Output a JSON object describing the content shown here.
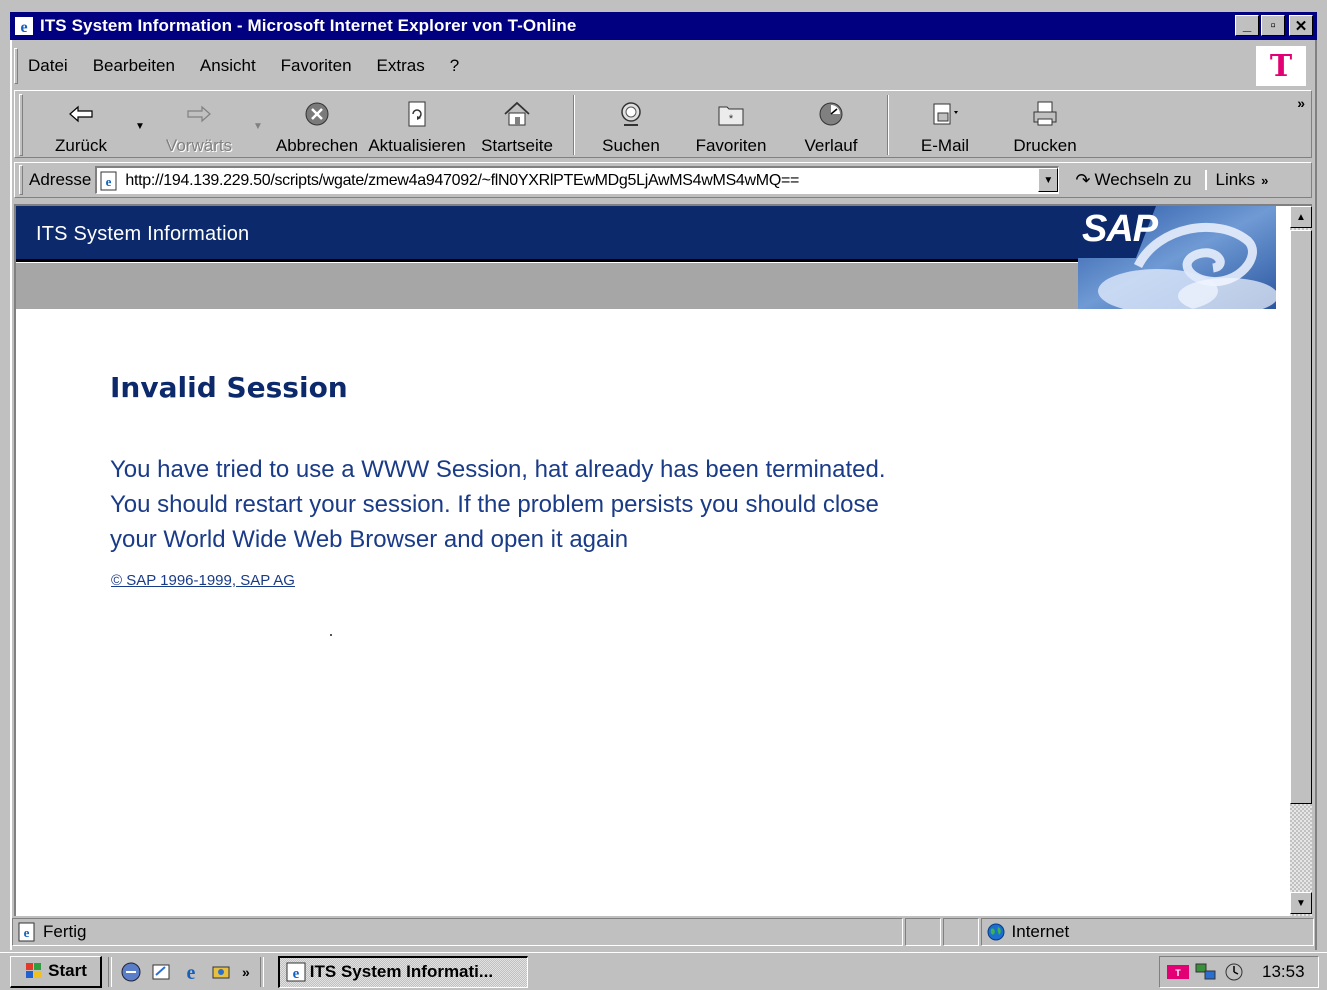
{
  "window": {
    "title": "ITS System Information - Microsoft Internet Explorer von T-Online"
  },
  "window_buttons": {
    "minimize": "_",
    "maximize": "▫",
    "close": "✕"
  },
  "menu": {
    "items": [
      {
        "label": "Datei"
      },
      {
        "label": "Bearbeiten"
      },
      {
        "label": "Ansicht"
      },
      {
        "label": "Favoriten"
      },
      {
        "label": "Extras"
      },
      {
        "label": "?"
      }
    ],
    "brand_logo": "T"
  },
  "toolbar": {
    "back": "Zurück",
    "forward": "Vorwärts",
    "stop": "Abbrechen",
    "refresh": "Aktualisieren",
    "home": "Startseite",
    "search": "Suchen",
    "favorites": "Favoriten",
    "history": "Verlauf",
    "mail": "E-Mail",
    "print": "Drucken",
    "more": "»"
  },
  "address_bar": {
    "label": "Adresse",
    "url": "http://194.139.229.50/scripts/wgate/zmew4a947092/~flN0YXRlPTEwMDg5LjAwMS4wMS4wMQ==",
    "go_label": "Wechseln zu",
    "links_label": "Links",
    "links_more": "»"
  },
  "page": {
    "banner_title": "ITS System Information",
    "sap_logo_text": "SAP",
    "heading": "Invalid Session",
    "body_lines": [
      "You have tried to use a WWW Session, hat already has been terminated.",
      "You should restart your session. If the problem persists you should close",
      "your World Wide Web Browser and open it again"
    ],
    "copyright": "© SAP 1996-1999, SAP AG"
  },
  "status_bar": {
    "text": "Fertig",
    "zone": "Internet"
  },
  "taskbar": {
    "start_label": "Start",
    "quick_launch_more": "»",
    "task_label": "ITS System Informati...",
    "clock": "13:53"
  },
  "colors": {
    "title_bar": "#000080",
    "banner": "#0c2a6b",
    "heading": "#0c2a6b",
    "body_text": "#1a3b87",
    "t_online_magenta": "#e20074"
  }
}
